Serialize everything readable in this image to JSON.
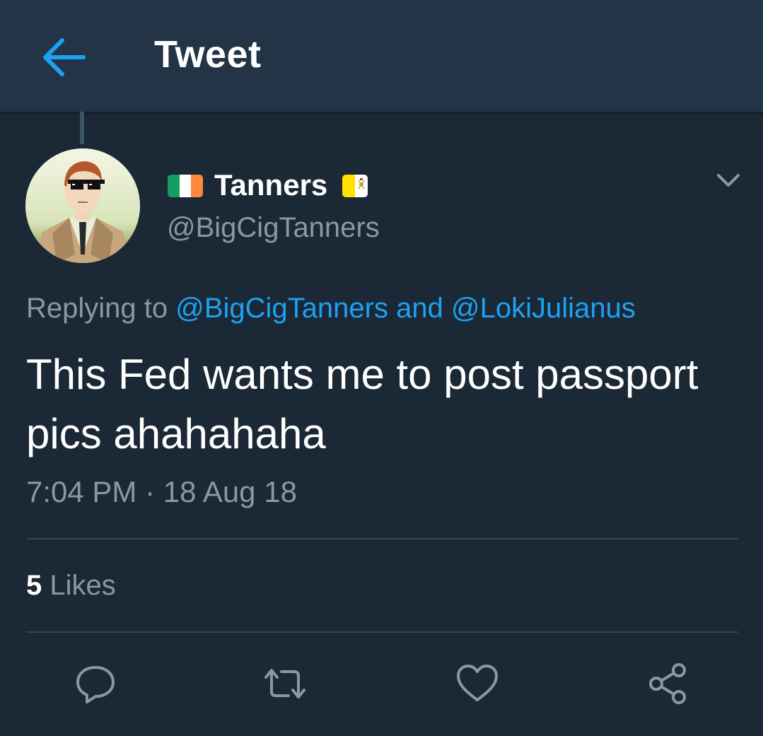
{
  "header": {
    "title": "Tweet",
    "back_icon": "arrow-left-icon"
  },
  "author": {
    "display_name": "Tanners",
    "handle": "@BigCigTanners",
    "flag_before": "ireland-flag",
    "flag_after": "vatican-flag"
  },
  "reply": {
    "prefix": "Replying to",
    "mention1": "@BigCigTanners",
    "joiner": "and",
    "mention2": "@LokiJulianus"
  },
  "tweet": {
    "text": "This Fed wants me to post passport pics ahahahaha",
    "timestamp": "7:04 PM · 18 Aug 18"
  },
  "stats": {
    "likes_count": "5",
    "likes_label": "Likes"
  },
  "actions": [
    "reply-icon",
    "retweet-icon",
    "like-icon",
    "share-icon"
  ],
  "colors": {
    "background": "#1b2836",
    "header": "#243447",
    "accent": "#1da1f2",
    "secondary_text": "#8899a6"
  }
}
